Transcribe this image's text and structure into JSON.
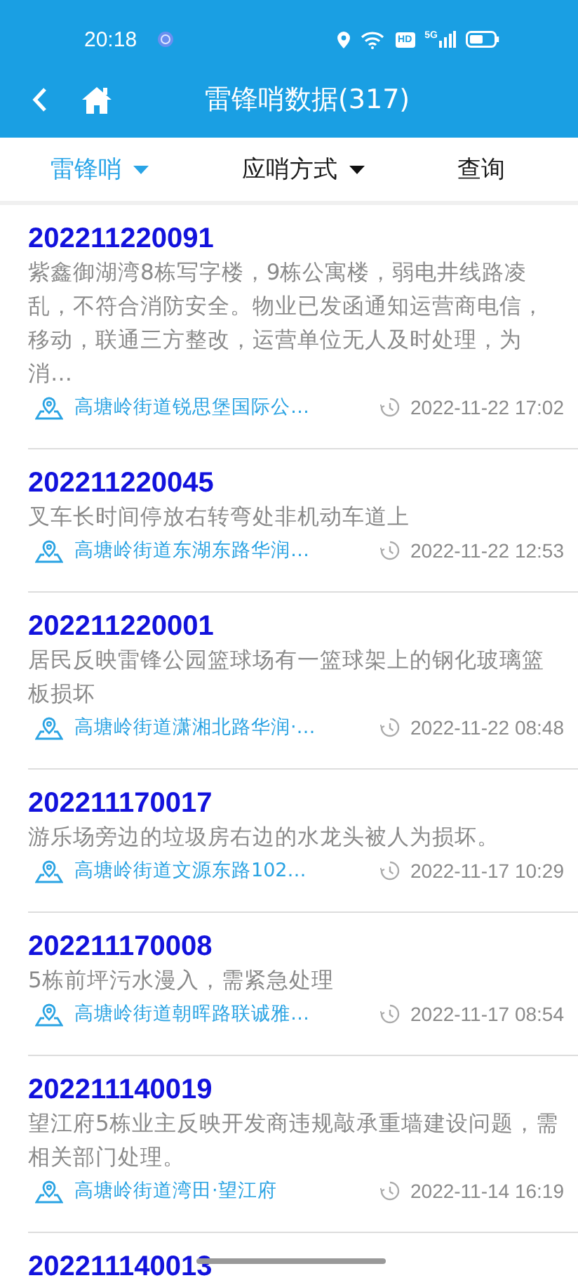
{
  "status_bar": {
    "time": "20:18",
    "hd_label": "HD",
    "network_label": "5G"
  },
  "header": {
    "title": "雷锋哨数据(317)"
  },
  "filters": [
    {
      "label": "雷锋哨",
      "selected": true,
      "dropdown": true
    },
    {
      "label": "应哨方式",
      "selected": false,
      "dropdown": true
    },
    {
      "label": "查询",
      "selected": false,
      "dropdown": false
    }
  ],
  "items": [
    {
      "id": "202211220091",
      "description": "紫鑫御湖湾8栋写字楼，9栋公寓楼，弱电井线路凌乱，不符合消防安全。物业已发函通知运营商电信，移动，联通三方整改，运营单位无人及时处理，为消…",
      "location": "高塘岭街道锐思堡国际公…",
      "time": "2022-11-22 17:02"
    },
    {
      "id": "202211220045",
      "description": "叉车长时间停放右转弯处非机动车道上",
      "location": "高塘岭街道东湖东路华润…",
      "time": "2022-11-22 12:53"
    },
    {
      "id": "202211220001",
      "description": "居民反映雷锋公园篮球场有一篮球架上的钢化玻璃篮板损坏",
      "location": "高塘岭街道潇湘北路华润·…",
      "time": "2022-11-22 08:48"
    },
    {
      "id": "202211170017",
      "description": "游乐场旁边的垃圾房右边的水龙头被人为损坏。",
      "location": "高塘岭街道文源东路102…",
      "time": "2022-11-17 10:29"
    },
    {
      "id": "202211170008",
      "description": "5栋前坪污水漫入，需紧急处理",
      "location": "高塘岭街道朝晖路联诚雅…",
      "time": "2022-11-17 08:54"
    },
    {
      "id": "202211140019",
      "description": "望江府5栋业主反映开发商违规敲承重墙建设问题，需相关部门处理。",
      "location": "高塘岭街道湾田·望江府",
      "time": "2022-11-14 16:19"
    },
    {
      "id": "202211140013"
    }
  ]
}
